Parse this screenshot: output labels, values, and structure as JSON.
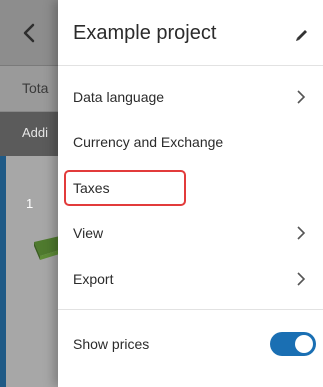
{
  "background": {
    "sub_label": "Tota",
    "dark_label": "Addi",
    "row_number": "1"
  },
  "drawer": {
    "title": "Example project",
    "items": [
      {
        "label": "Data language",
        "chevron": true
      },
      {
        "label": "Currency and Exchange",
        "chevron": false
      },
      {
        "label": "Taxes",
        "chevron": false,
        "highlighted": true
      },
      {
        "label": "View",
        "chevron": true
      },
      {
        "label": "Export",
        "chevron": true
      }
    ],
    "show_prices": {
      "label": "Show prices",
      "enabled": true
    }
  },
  "colors": {
    "highlight_border": "#e23b3b",
    "toggle_on": "#1a6fb3"
  },
  "icons": {
    "back": "chevron-left-icon",
    "edit": "pencil-icon",
    "submenu": "chevron-right-icon"
  }
}
